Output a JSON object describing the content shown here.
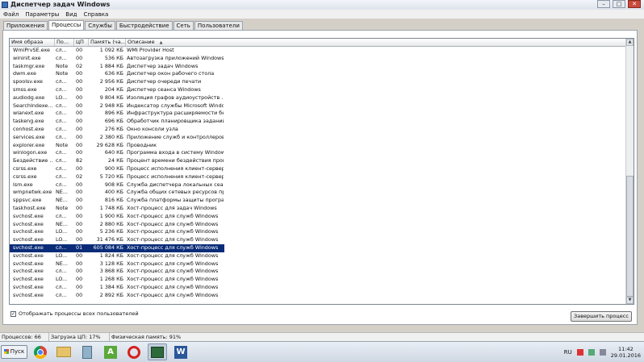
{
  "window": {
    "title": "Диспетчер задач Windows",
    "btn_min": "–",
    "btn_max": "□",
    "btn_close": "✕"
  },
  "menu": [
    "Файл",
    "Параметры",
    "Вид",
    "Справка"
  ],
  "tabs": [
    "Приложения",
    "Процессы",
    "Службы",
    "Быстродействие",
    "Сеть",
    "Пользователи"
  ],
  "active_tab_index": 1,
  "columns": [
    "Имя образа",
    "По...",
    "ЦП",
    "Память (ча...",
    "Описание"
  ],
  "processes": [
    {
      "name": "WmiPrvSE.exe",
      "user": "сл...",
      "cpu": "00",
      "mem": "1 092 КБ",
      "desc": "WMI Provider Host"
    },
    {
      "name": "wininit.exe",
      "user": "сл...",
      "cpu": "00",
      "mem": "536 КБ",
      "desc": "Автозагрузка приложений Windows"
    },
    {
      "name": "taskmgr.exe",
      "user": "Note",
      "cpu": "02",
      "mem": "1 884 КБ",
      "desc": "Диспетчер задач Windows"
    },
    {
      "name": "dwm.exe",
      "user": "Note",
      "cpu": "00",
      "mem": "636 КБ",
      "desc": "Диспетчер окон рабочего стола"
    },
    {
      "name": "spoolsv.exe",
      "user": "сл...",
      "cpu": "00",
      "mem": "2 956 КБ",
      "desc": "Диспетчер очереди печати"
    },
    {
      "name": "smss.exe",
      "user": "сл...",
      "cpu": "00",
      "mem": "204 КБ",
      "desc": "Диспетчер сеанса  Windows"
    },
    {
      "name": "audiodg.exe",
      "user": "LO...",
      "cpu": "00",
      "mem": "9 804 КБ",
      "desc": "Изоляция графов аудиоустройств ..."
    },
    {
      "name": "SearchIndexe...",
      "user": "сл...",
      "cpu": "00",
      "mem": "2 948 КБ",
      "desc": "Индексатор службы Microsoft Windo..."
    },
    {
      "name": "wlanext.exe",
      "user": "сл...",
      "cpu": "00",
      "mem": "896 КБ",
      "desc": "Инфраструктура расширяемости бе..."
    },
    {
      "name": "taskeng.exe",
      "user": "сл...",
      "cpu": "00",
      "mem": "696 КБ",
      "desc": "Обработчик планировщика заданий"
    },
    {
      "name": "conhost.exe",
      "user": "сл...",
      "cpu": "00",
      "mem": "276 КБ",
      "desc": "Окно консоли узла"
    },
    {
      "name": "services.exe",
      "user": "сл...",
      "cpu": "00",
      "mem": "2 380 КБ",
      "desc": "Приложение служб и контроллеров"
    },
    {
      "name": "explorer.exe",
      "user": "Note",
      "cpu": "00",
      "mem": "29 628 КБ",
      "desc": "Проводник"
    },
    {
      "name": "winlogon.exe",
      "user": "сл...",
      "cpu": "00",
      "mem": "640 КБ",
      "desc": "Программа входа в систему Windows"
    },
    {
      "name": "Бездействие ...",
      "user": "сл...",
      "cpu": "82",
      "mem": "24 КБ",
      "desc": "Процент времени бездействия проц..."
    },
    {
      "name": "csrss.exe",
      "user": "сл...",
      "cpu": "00",
      "mem": "900 КБ",
      "desc": "Процесс исполнения клиент-сервер"
    },
    {
      "name": "csrss.exe",
      "user": "сл...",
      "cpu": "02",
      "mem": "5 720 КБ",
      "desc": "Процесс исполнения клиент-сервер"
    },
    {
      "name": "lsm.exe",
      "user": "сл...",
      "cpu": "00",
      "mem": "908 КБ",
      "desc": "Служба диспетчера локальных сеа..."
    },
    {
      "name": "wmpnetwk.exe",
      "user": "NE...",
      "cpu": "00",
      "mem": "400 КБ",
      "desc": "Служба общих сетевых ресурсов пр..."
    },
    {
      "name": "sppsvc.exe",
      "user": "NE...",
      "cpu": "00",
      "mem": "816 КБ",
      "desc": "Служба платформы защиты програ..."
    },
    {
      "name": "taskhost.exe",
      "user": "Note",
      "cpu": "00",
      "mem": "1 748 КБ",
      "desc": "Хост-процесс для задач Windows"
    },
    {
      "name": "svchost.exe",
      "user": "сл...",
      "cpu": "00",
      "mem": "1 900 КБ",
      "desc": "Хост-процесс для служб Windows"
    },
    {
      "name": "svchost.exe",
      "user": "NE...",
      "cpu": "00",
      "mem": "2 880 КБ",
      "desc": "Хост-процесс для служб Windows"
    },
    {
      "name": "svchost.exe",
      "user": "LO...",
      "cpu": "00",
      "mem": "5 236 КБ",
      "desc": "Хост-процесс для служб Windows"
    },
    {
      "name": "svchost.exe",
      "user": "LO...",
      "cpu": "00",
      "mem": "31 476 КБ",
      "desc": "Хост-процесс для служб Windows"
    },
    {
      "name": "svchost.exe",
      "user": "сл...",
      "cpu": "01",
      "mem": "605 084 КБ",
      "desc": "Хост-процесс для служб Windows",
      "selected": true
    },
    {
      "name": "svchost.exe",
      "user": "LO...",
      "cpu": "00",
      "mem": "1 824 КБ",
      "desc": "Хост-процесс для служб Windows"
    },
    {
      "name": "svchost.exe",
      "user": "NE...",
      "cpu": "00",
      "mem": "3 128 КБ",
      "desc": "Хост-процесс для служб Windows"
    },
    {
      "name": "svchost.exe",
      "user": "сл...",
      "cpu": "00",
      "mem": "3 868 КБ",
      "desc": "Хост-процесс для служб Windows"
    },
    {
      "name": "svchost.exe",
      "user": "LO...",
      "cpu": "00",
      "mem": "1 268 КБ",
      "desc": "Хост-процесс для служб Windows"
    },
    {
      "name": "svchost.exe",
      "user": "сл...",
      "cpu": "00",
      "mem": "1 384 КБ",
      "desc": "Хост-процесс для служб Windows"
    },
    {
      "name": "svchost.exe",
      "user": "сл...",
      "cpu": "00",
      "mem": "2 892 КБ",
      "desc": "Хост-процесс для служб Windows"
    }
  ],
  "show_all_users": {
    "label": "Отображать процессы всех пользователей",
    "checked": true,
    "mark": "✓"
  },
  "end_process_label": "Завершить процесс",
  "status": {
    "processes": "Процессов: 66",
    "cpu": "Загрузка ЦП: 17%",
    "memory": "Физическая память: 91%"
  },
  "taskbar": {
    "start_label": "Пуск",
    "apps": [
      "chrome-icon",
      "folder-icon",
      "calculator-icon",
      "a-app-icon",
      "opera-icon",
      "task-manager-icon",
      "word-icon"
    ],
    "a_app_letter": "A",
    "word_letter": "W",
    "lang": "RU",
    "time": "11:42",
    "date": "29.01.2016"
  }
}
